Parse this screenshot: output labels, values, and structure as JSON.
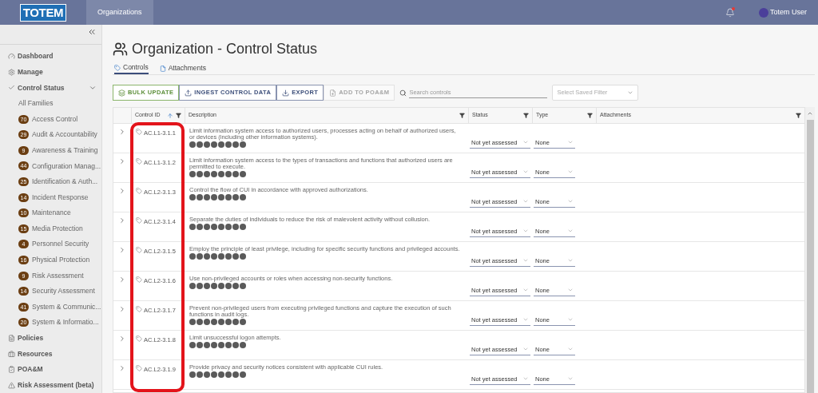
{
  "topbar": {
    "logo": "TOTEM",
    "nav": [
      {
        "label": "Organizations",
        "selected": true
      }
    ],
    "notification_unread": true,
    "user": "Totem User"
  },
  "sidebar": {
    "items": [
      {
        "label": "Dashboard"
      },
      {
        "label": "Manage"
      },
      {
        "label": "Control Status",
        "expanded": true,
        "children": [
          {
            "label": "All Families"
          },
          {
            "label": "Access Control",
            "count": "70"
          },
          {
            "label": "Audit & Accountability",
            "count": "29"
          },
          {
            "label": "Awareness & Training",
            "count": "9"
          },
          {
            "label": "Configuration Manag...",
            "count": "44"
          },
          {
            "label": "Identification & Auth...",
            "count": "25"
          },
          {
            "label": "Incident Response",
            "count": "14"
          },
          {
            "label": "Maintenance",
            "count": "10"
          },
          {
            "label": "Media Protection",
            "count": "15"
          },
          {
            "label": "Personnel Security",
            "count": "4"
          },
          {
            "label": "Physical Protection",
            "count": "16"
          },
          {
            "label": "Risk Assessment",
            "count": "9"
          },
          {
            "label": "Security Assessment",
            "count": "14"
          },
          {
            "label": "System & Communic...",
            "count": "41"
          },
          {
            "label": "System & Informatio...",
            "count": "20"
          }
        ]
      },
      {
        "label": "Policies"
      },
      {
        "label": "Resources"
      },
      {
        "label": "POA&M"
      },
      {
        "label": "Risk Assessment (beta)"
      }
    ]
  },
  "page": {
    "title": "Organization - Control Status",
    "tabs": [
      {
        "label": "Controls",
        "selected": true
      },
      {
        "label": "Attachments",
        "selected": false
      }
    ],
    "toolbar": [
      {
        "label": "BULK UPDATE",
        "kind": "bulk",
        "disabled": false
      },
      {
        "label": "INGEST CONTROL DATA",
        "kind": "upload",
        "disabled": false
      },
      {
        "label": "EXPORT",
        "kind": "download",
        "disabled": false
      },
      {
        "label": "ADD TO POA&M",
        "kind": "poam",
        "disabled": true
      }
    ],
    "search": {
      "placeholder": "Search controls"
    },
    "saved_filter": {
      "placeholder": "Select Saved Filter"
    }
  },
  "table": {
    "columns": [
      {
        "label": "Control ID",
        "sorted_ascending": true
      },
      {
        "label": "Description",
        "sorted_ascending": false
      },
      {
        "label": "Status",
        "sorted_ascending": false
      },
      {
        "label": "Type",
        "sorted_ascending": false
      },
      {
        "label": "Attachments",
        "sorted_ascending": false
      }
    ],
    "rows": [
      {
        "id": "AC.L1-3.1.1",
        "description": "Limit information system access to authorized users, processes acting on behalf of authorized users, or devices (including other information systems).",
        "status": "Not yet assessed",
        "type": "None"
      },
      {
        "id": "AC.L1-3.1.2",
        "description": "Limit information system access to the types of transactions and functions that authorized users are permitted to execute.",
        "status": "Not yet assessed",
        "type": "None"
      },
      {
        "id": "AC.L2-3.1.3",
        "description": "Control the flow of CUI in accordance with approved authorizations.",
        "status": "Not yet assessed",
        "type": "None"
      },
      {
        "id": "AC.L2-3.1.4",
        "description": "Separate the duties of individuals to reduce the risk of malevolent activity without collusion.",
        "status": "Not yet assessed",
        "type": "None"
      },
      {
        "id": "AC.L2-3.1.5",
        "description": "Employ the principle of least privilege, including for specific security functions and privileged accounts.",
        "status": "Not yet assessed",
        "type": "None"
      },
      {
        "id": "AC.L2-3.1.6",
        "description": "Use non-privileged accounts or roles when accessing non-security functions.",
        "status": "Not yet assessed",
        "type": "None"
      },
      {
        "id": "AC.L2-3.1.7",
        "description": "Prevent non-privileged users from executing privileged functions and capture the execution of such functions in audit logs.",
        "status": "Not yet assessed",
        "type": "None"
      },
      {
        "id": "AC.L2-3.1.8",
        "description": "Limit unsuccessful logon attempts.",
        "status": "Not yet assessed",
        "type": "None"
      },
      {
        "id": "AC.L2-3.1.9",
        "description": "Provide privacy and security notices consistent with applicable CUI rules.",
        "status": "Not yet assessed",
        "type": "None"
      }
    ]
  },
  "annotation": {
    "kind": "outline"
  }
}
